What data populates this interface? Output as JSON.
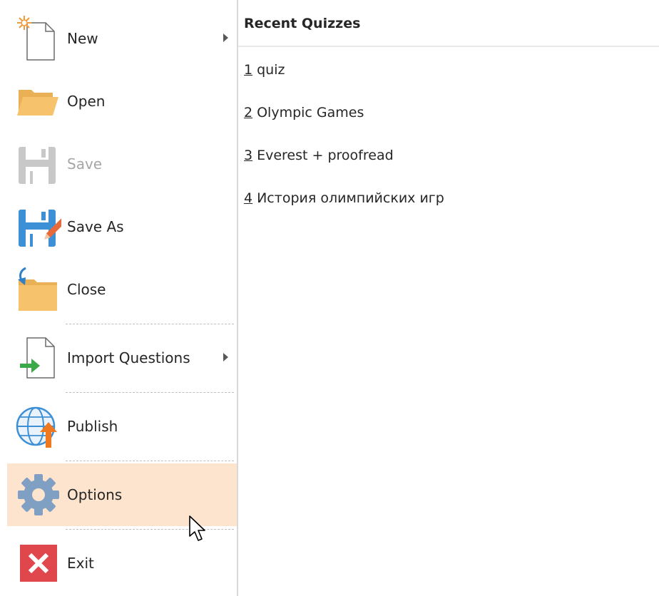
{
  "menu": {
    "items": [
      {
        "label": "New",
        "icon": "new-document-icon",
        "submenu": true
      },
      {
        "label": "Open",
        "icon": "open-folder-icon"
      },
      {
        "label": "Save",
        "icon": "save-disk-icon",
        "disabled": true
      },
      {
        "label": "Save As",
        "icon": "save-as-icon"
      },
      {
        "label": "Close",
        "icon": "close-folder-icon"
      },
      {
        "label": "Import Questions",
        "icon": "import-questions-icon",
        "submenu": true
      },
      {
        "label": "Publish",
        "icon": "publish-globe-icon"
      },
      {
        "label": "Options",
        "icon": "gear-icon",
        "highlighted": true
      },
      {
        "label": "Exit",
        "icon": "exit-x-icon"
      }
    ]
  },
  "recent": {
    "title": "Recent Quizzes",
    "items": [
      {
        "num": "1",
        "name": "quiz"
      },
      {
        "num": "2",
        "name": "Olympic Games"
      },
      {
        "num": "3",
        "name": "Everest + proofread"
      },
      {
        "num": "4",
        "name": "История олимпийских игр"
      }
    ]
  },
  "colors": {
    "accent": "#f0a25e",
    "highlight": "#fde4cf",
    "folder": "#f6c26b",
    "save_blue": "#3d8fd6",
    "exit_red": "#e0474c",
    "gear_blue": "#7f9fc3"
  }
}
